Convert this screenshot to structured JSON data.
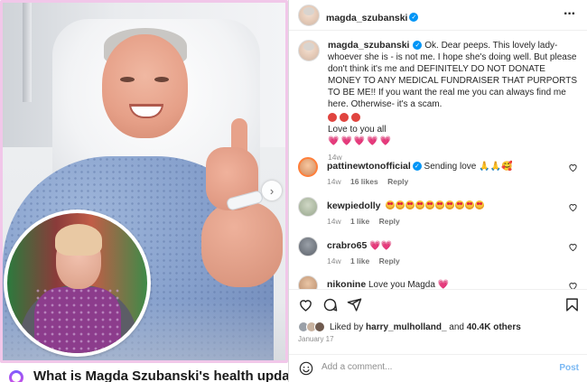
{
  "post": {
    "author": "magda_szubanski",
    "caption": "Ok. Dear peeps. This lovely lady- whoever she is - is not me. I hope she's doing well. But please don't think it's me and DEFINITELY DO NOT DONATE MONEY TO ANY MEDICAL FUNDRAISER THAT PURPORTS TO BE ME!! If you want the real me you can always find me here. Otherwise- it's a scam.",
    "sign_off": "Love to you all",
    "hearts": "💗💗💗💗💗",
    "time": "14w"
  },
  "comments": [
    {
      "user": "pattinewtonofficial",
      "text": "Sending love 🙏🙏🥰",
      "time": "14w",
      "likes": "16 likes",
      "reply": "Reply",
      "verified": true
    },
    {
      "user": "kewpiedolly",
      "text": "",
      "time": "14w",
      "likes": "1 like",
      "reply": "Reply",
      "verified": false
    },
    {
      "user": "crabro65",
      "text": "💗💗",
      "time": "14w",
      "likes": "1 like",
      "reply": "Reply",
      "verified": false
    },
    {
      "user": "nikonine",
      "text": "Love you Magda 💗",
      "time": "",
      "likes": "",
      "reply": "",
      "verified": false
    }
  ],
  "likes_summary": {
    "prefix": "Liked by ",
    "user": "harry_mulholland_",
    "middle": " and ",
    "count": "40.4K others"
  },
  "date": "January 17",
  "add_comment": {
    "placeholder": "Add a comment...",
    "post_label": "Post"
  },
  "article": {
    "headline": "What is Magda Szubanski's health update"
  },
  "icons": {
    "more": "more-options-icon",
    "next": "chevron-right-icon",
    "like": "heart-icon",
    "comment": "comment-icon",
    "share": "share-icon",
    "save": "bookmark-icon",
    "emoji": "smiley-icon",
    "verified": "verified-badge-icon"
  },
  "colors": {
    "verified": "#0095f6",
    "post_button": "#7ab8f3",
    "photo_border": "#f1c7e9"
  }
}
